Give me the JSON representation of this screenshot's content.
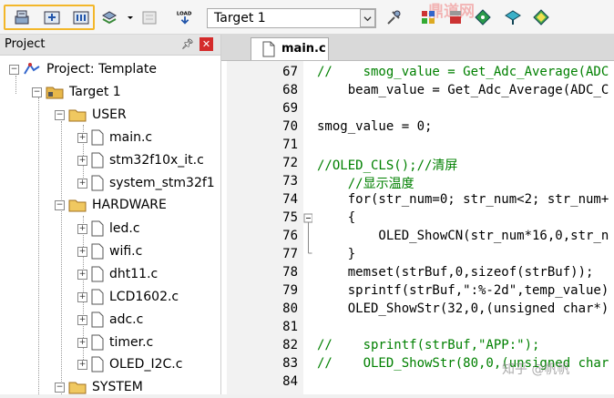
{
  "toolbar": {
    "target": "Target 1",
    "buttons": [
      "translate-icon",
      "build-icon",
      "rebuild-icon",
      "batch-build-icon",
      "stop-build-icon",
      "download-icon",
      "options-icon",
      "manage-project-icon",
      "components-icon",
      "pack-installer-icon",
      "run-icon"
    ],
    "watermark": "鼎道网"
  },
  "project": {
    "title": "Project",
    "root": "Project: Template",
    "target": "Target 1",
    "groups": [
      {
        "name": "USER",
        "files": [
          "main.c",
          "stm32f10x_it.c",
          "system_stm32f1"
        ]
      },
      {
        "name": "HARDWARE",
        "files": [
          "led.c",
          "wifi.c",
          "dht11.c",
          "LCD1602.c",
          "adc.c",
          "timer.c",
          "OLED_I2C.c"
        ]
      },
      {
        "name": "SYSTEM",
        "files": []
      }
    ]
  },
  "editor": {
    "tab": "main.c",
    "lines": [
      {
        "n": "67",
        "t": "//    smog_value = Get_Adc_Average(ADC"
      },
      {
        "n": "68",
        "t": "    beam_value = Get_Adc_Average(ADC_C"
      },
      {
        "n": "69",
        "t": ""
      },
      {
        "n": "70",
        "t": "smog_value = 0;"
      },
      {
        "n": "71",
        "t": ""
      },
      {
        "n": "72",
        "t": "//OLED_CLS();//清屏"
      },
      {
        "n": "73",
        "t": "    //显示温度"
      },
      {
        "n": "74",
        "t": "    for(str_num=0; str_num<2; str_num+"
      },
      {
        "n": "75",
        "t": "    {"
      },
      {
        "n": "76",
        "t": "        OLED_ShowCN(str_num*16,0,str_n"
      },
      {
        "n": "77",
        "t": "    }"
      },
      {
        "n": "78",
        "t": "    memset(strBuf,0,sizeof(strBuf));"
      },
      {
        "n": "79",
        "t": "    sprintf(strBuf,\":%-2d\",temp_value)"
      },
      {
        "n": "80",
        "t": "    OLED_ShowStr(32,0,(unsigned char*)"
      },
      {
        "n": "81",
        "t": ""
      },
      {
        "n": "82",
        "t": "//    sprintf(strBuf,\"APP:\");"
      },
      {
        "n": "83",
        "t": "//    OLED_ShowStr(80,0,(unsigned char"
      },
      {
        "n": "84",
        "t": ""
      }
    ],
    "watermark": "知乎 @帆帆"
  }
}
